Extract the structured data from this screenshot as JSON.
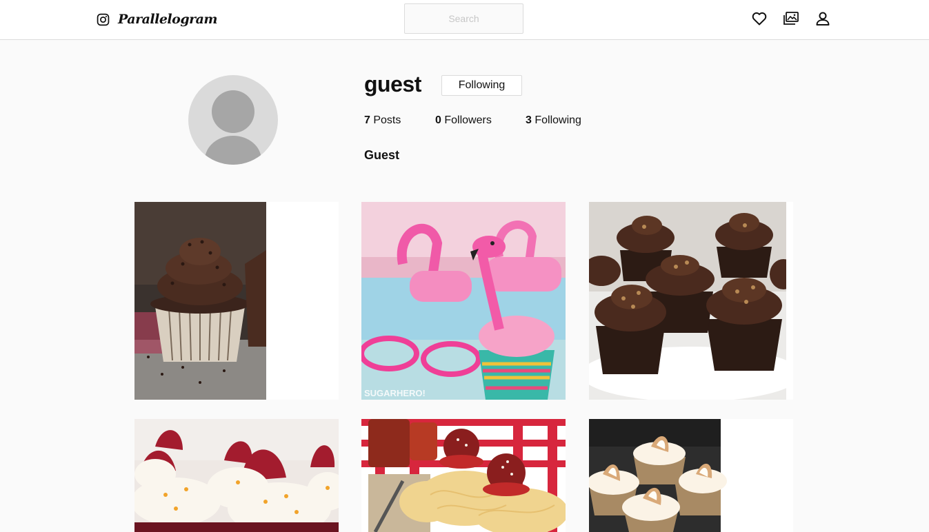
{
  "app": {
    "brand_name": "Parallelogram",
    "icons": [
      "instagram-logo-icon",
      "heart-icon",
      "gallery-icon",
      "person-icon"
    ]
  },
  "search": {
    "placeholder": "Search",
    "value": ""
  },
  "profile": {
    "username": "guest",
    "follow_button_label": "Following",
    "posts_count": "7",
    "posts_label": "Posts",
    "followers_count": "0",
    "followers_label": "Followers",
    "following_count": "3",
    "following_label": "Following",
    "full_name": "Guest"
  },
  "posts": [
    {
      "subject": "chocolate cupcake with swirled chocolate frosting"
    },
    {
      "subject": "pink flamingo cupcakes",
      "watermark": "SUGARHERO!"
    },
    {
      "subject": "chocolate cupcakes with chocolate frosting"
    },
    {
      "subject": "red velvet cupcakes with cream cheese frosting"
    },
    {
      "subject": "spaghetti and meatball cupcakes"
    },
    {
      "subject": "toasted meringue cupcakes"
    }
  ],
  "colors": {
    "nav_bg": "#ffffff",
    "page_bg": "#fafafa",
    "border": "#dbdbdb",
    "avatar_bg": "#dadada",
    "avatar_fg": "#a6a6a6"
  }
}
